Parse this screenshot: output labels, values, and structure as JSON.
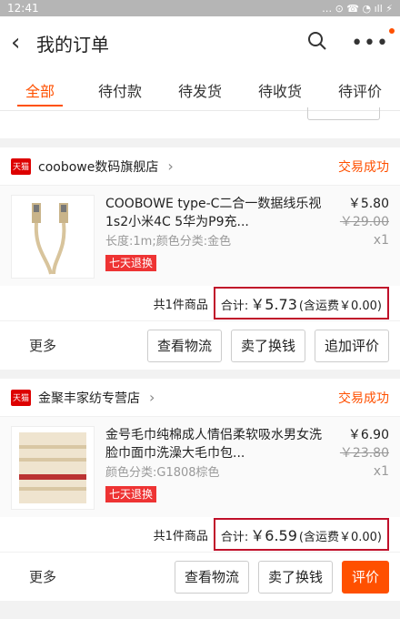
{
  "statusbar": {
    "time": "12:41",
    "icons": "… ⊙ ☎ ◔ ıll ⚡"
  },
  "navbar": {
    "back_icon": "‹",
    "title": "我的订单",
    "more_icon": "•••"
  },
  "tabs": [
    {
      "label": "全部"
    },
    {
      "label": "待付款"
    },
    {
      "label": "待发货"
    },
    {
      "label": "待收货"
    },
    {
      "label": "待评价"
    }
  ],
  "orders": [
    {
      "shop_badge": "天猫",
      "shop_name": "coobowe数码旗舰店",
      "status": "交易成功",
      "item_name": "COOBOWE type-C二合一数据线乐视1s2小米4C 5华为P9充...",
      "spec": "长度:1m;颜色分类:金色",
      "badge": "七天退换",
      "price": "￥5.80",
      "orig_price": "￥29.00",
      "qty": "x1",
      "count_text": "共1件商品",
      "total_label": "合计:",
      "total_value": "￥5.73",
      "shipping": "(含运费￥0.00)",
      "more": "更多",
      "btns": [
        "查看物流",
        "卖了换钱",
        "追加评价"
      ]
    },
    {
      "shop_badge": "天猫",
      "shop_name": "金聚丰家纺专营店",
      "status": "交易成功",
      "item_name": "金号毛巾纯棉成人情侣柔软吸水男女洗脸巾面巾洗澡大毛巾包...",
      "spec": "颜色分类:G1808棕色",
      "badge": "七天退换",
      "price": "￥6.90",
      "orig_price": "￥23.80",
      "qty": "x1",
      "count_text": "共1件商品",
      "total_label": "合计:",
      "total_value": "￥6.59",
      "shipping": "(含运费￥0.00)",
      "more": "更多",
      "btns": [
        "查看物流",
        "卖了换钱",
        "评价"
      ]
    }
  ],
  "colors": {
    "accent": "#ff5000",
    "highlight_box": "#c0102a",
    "tmall_red": "#dd0000"
  }
}
